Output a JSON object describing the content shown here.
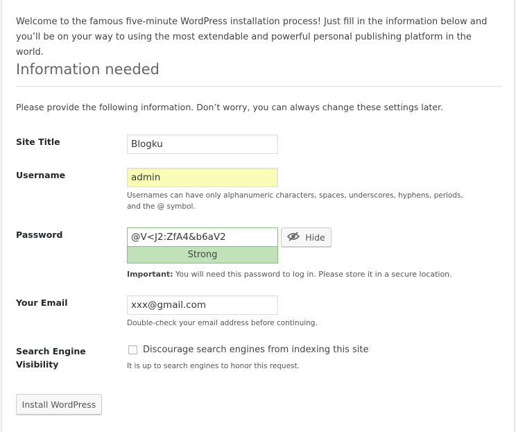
{
  "intro": "Welcome to the famous five-minute WordPress installation process! Just fill in the information below and you’ll be on your way to using the most extendable and powerful personal publishing platform in the world.",
  "section": {
    "heading": "Information needed",
    "description": "Please provide the following information. Don’t worry, you can always change these settings later."
  },
  "fields": {
    "site_title": {
      "label": "Site Title",
      "value": "Blogku"
    },
    "username": {
      "label": "Username",
      "value": "admin",
      "hint": "Usernames can have only alphanumeric characters, spaces, underscores, hyphens, periods, and the @ symbol."
    },
    "password": {
      "label": "Password",
      "value": "@V<J2:ZfA4&b6aV2",
      "hide_label": "Hide",
      "strength": "Strong",
      "hint_strong": "Important:",
      "hint": " You will need this password to log in. Please store it in a secure location."
    },
    "email": {
      "label": "Your Email",
      "value": "xxx@gmail.com",
      "hint": "Double-check your email address before continuing."
    },
    "search_engine": {
      "label_line1": "Search Engine",
      "label_line2": "Visibility",
      "checkbox_label": "Discourage search engines from indexing this site",
      "checked": false,
      "hint": "It is up to search engines to honor this request."
    }
  },
  "install_button": "Install WordPress",
  "colors": {
    "strength_bg": "#c1e1b9",
    "strength_border": "#83c373",
    "username_bg": "#fafdb6"
  },
  "icons": {
    "hide": "eye-slash-icon"
  }
}
